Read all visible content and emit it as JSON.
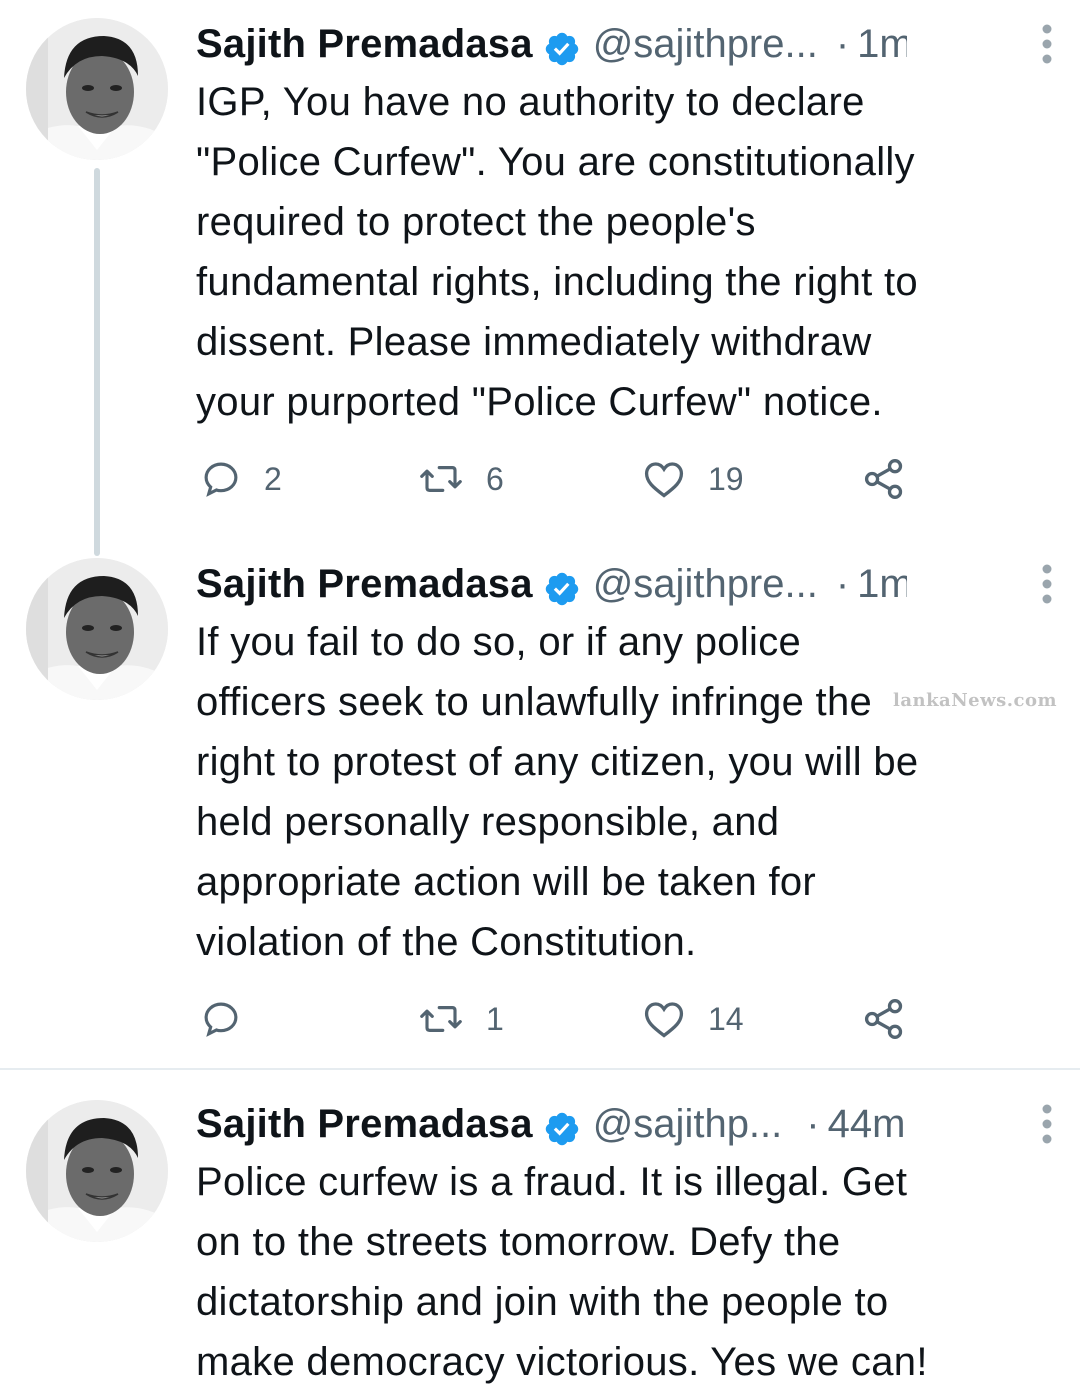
{
  "tweets": [
    {
      "name": "Sajith Premadasa",
      "handle": "@sajithpre...",
      "separator": "·",
      "time": "1m",
      "text": "IGP, You have no authority to declare\n\"Police Curfew\". You are constitutionally\nrequired to protect the people's\nfundamental rights, including the right to\ndissent. Please immediately withdraw\nyour purported \"Police Curfew\" notice.",
      "replies": "2",
      "retweets": "6",
      "likes": "19"
    },
    {
      "name": "Sajith Premadasa",
      "handle": "@sajithpre...",
      "separator": "·",
      "time": "1m",
      "text": "If you fail to do so, or if any police\nofficers seek to unlawfully infringe the\nright to protest of any citizen, you will be\nheld personally responsible, and\nappropriate action will be taken for\nviolation of the Constitution.",
      "replies": "",
      "retweets": "1",
      "likes": "14"
    },
    {
      "name": "Sajith Premadasa",
      "handle": "@sajithp...",
      "separator": "·",
      "time": "44m",
      "text": "Police curfew is a fraud. It is illegal. Get\non to the streets tomorrow. Defy the\ndictatorship and join with the people to\nmake democracy victorious. Yes we can!",
      "replies": "",
      "retweets": "",
      "likes": ""
    }
  ],
  "watermark": "lankaNews.com",
  "colors": {
    "verified": "#1d9bf0",
    "muted": "#536471",
    "text": "#0f1419",
    "thread_line": "#cfd9de"
  },
  "icons": [
    "verified-badge-icon",
    "more-options-icon",
    "reply-icon",
    "retweet-icon",
    "like-icon",
    "share-icon"
  ]
}
